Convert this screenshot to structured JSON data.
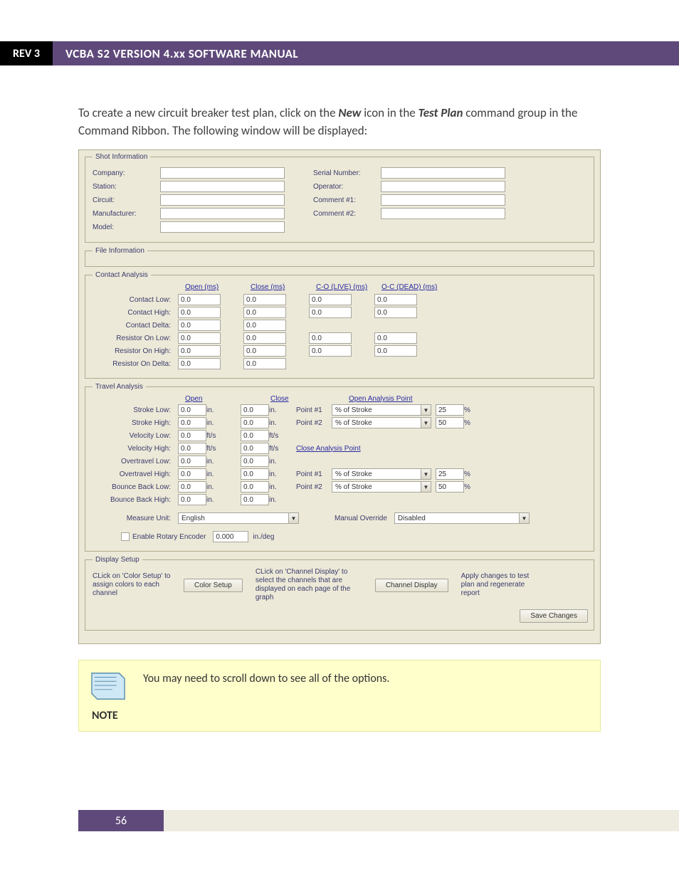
{
  "header": {
    "rev": "REV 3",
    "title": "VCBA S2 VERSION 4.xx SOFTWARE MANUAL"
  },
  "intro": {
    "prefix": "To create a new circuit breaker test plan, click on the ",
    "new": "New",
    "mid": " icon in the ",
    "testplan": "Test Plan",
    "suffix": " command group in the Command Ribbon. The following window will be displayed:"
  },
  "shotInfo": {
    "legend": "Shot Information",
    "company": "Company:",
    "serial": "Serial Number:",
    "station": "Station:",
    "operator": "Operator:",
    "circuit": "Circuit:",
    "comment1": "Comment #1:",
    "manufacturer": "Manufacturer:",
    "comment2": "Comment #2:",
    "model": "Model:"
  },
  "fileInfo": {
    "legend": "File Information"
  },
  "contact": {
    "legend": "Contact Analysis",
    "cols": {
      "open": "Open (ms)",
      "close": "Close (ms)",
      "co": "C-O (LIVE) (ms)",
      "oc": "O-C (DEAD) (ms)"
    },
    "rows": {
      "clow": "Contact Low:",
      "chigh": "Contact High:",
      "cdelta": "Contact Delta:",
      "rlow": "Resistor On Low:",
      "rhigh": "Resistor On High:",
      "rdelta": "Resistor On Delta:"
    },
    "val": "0.0"
  },
  "travel": {
    "legend": "Travel Analysis",
    "cols": {
      "open": "Open",
      "close": "Close",
      "oap": "Open Analysis Point",
      "cap": "Close Analysis Point"
    },
    "rows": {
      "slow": "Stroke Low:",
      "shigh": "Stroke High:",
      "vlow": "Velocity Low:",
      "vhigh": "Velocity High:",
      "olow": "Overtravel Low:",
      "ohigh": "Overtravel High:",
      "blow": "Bounce Back Low:",
      "bhigh": "Bounce Back High:"
    },
    "units": {
      "in": "in.",
      "fts": "ft/s"
    },
    "val": "0.0",
    "point1": "Point #1",
    "point2": "Point #2",
    "pctStroke": "% of Stroke",
    "p1val": "25",
    "p2val": "50",
    "pct": "%",
    "measure": "Measure Unit:",
    "measureVal": "English",
    "manual": "Manual Override",
    "manualVal": "Disabled",
    "rotary": "Enable Rotary Encoder",
    "rotaryVal": "0.000",
    "rotaryUnit": "in./deg"
  },
  "display": {
    "legend": "Display Setup",
    "colorTxt": "CLick on 'Color Setup' to assign colors to each channel",
    "colorBtn": "Color Setup",
    "chanTxt": "CLick on 'Channel Display' to select the channels that are displayed on each page of the graph",
    "chanBtn": "Channel Display",
    "applyTxt": "Apply changes to test plan and regenerate report",
    "saveBtn": "Save Changes"
  },
  "note": {
    "text": "You may need to scroll down to see all of the options.",
    "label": "NOTE"
  },
  "footer": {
    "page": "56"
  }
}
